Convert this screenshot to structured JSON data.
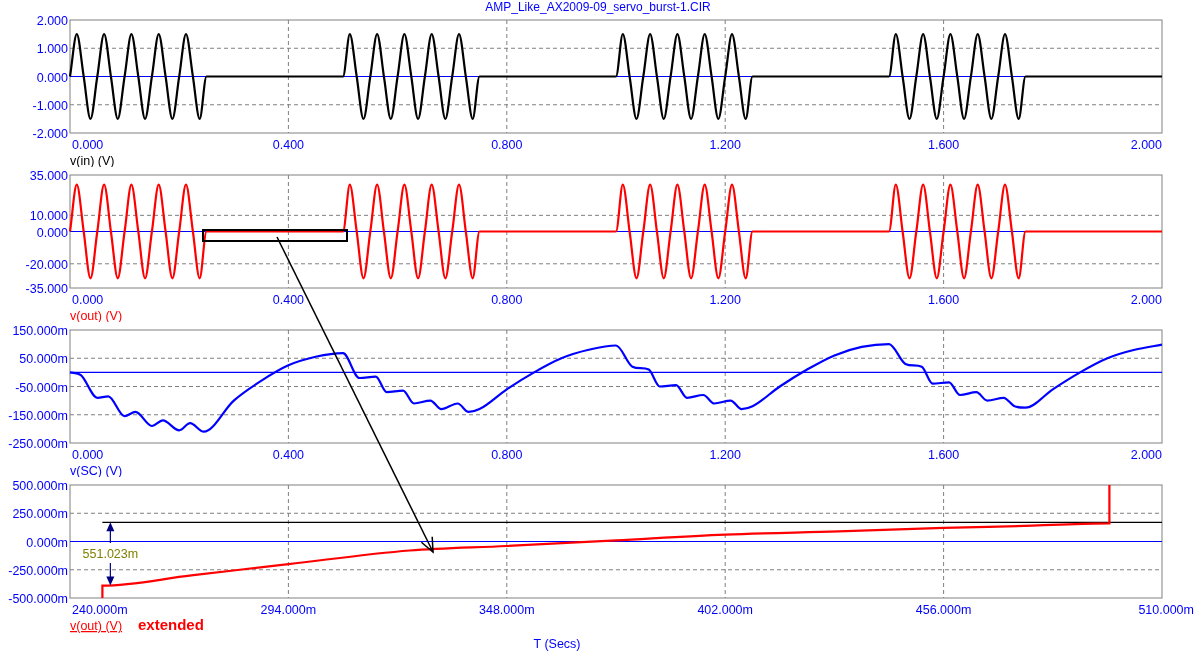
{
  "title": "AMP_Like_AX2009-09_servo_burst-1.CIR",
  "plots": [
    {
      "chart_data": {
        "type": "line",
        "grid": true,
        "ref_lines": [
          {
            "axis": "y",
            "value": 0,
            "color": "#0000ff"
          }
        ],
        "xlim": [
          0,
          2
        ],
        "ylim": [
          -2,
          2
        ],
        "xticks": [
          {
            "value": 0,
            "label": "0.000"
          },
          {
            "value": 0.4,
            "label": "0.400"
          },
          {
            "value": 0.8,
            "label": "0.800"
          },
          {
            "value": 1.2,
            "label": "1.200"
          },
          {
            "value": 1.6,
            "label": "1.600"
          },
          {
            "value": 2,
            "label": "2.000"
          }
        ],
        "yticks": [
          {
            "value": 2,
            "label": "2.000"
          },
          {
            "value": 1,
            "label": "1.000"
          },
          {
            "value": 0,
            "label": "0.000"
          },
          {
            "value": -1,
            "label": "-1.000"
          },
          {
            "value": -2,
            "label": "-2.000"
          }
        ],
        "x": [
          0,
          0.0125,
          0.025,
          0.0375,
          0.05,
          0.0625,
          0.075,
          0.0875,
          0.1,
          0.1125,
          0.125,
          0.1375,
          0.15,
          0.1625,
          0.175,
          0.1875,
          0.2,
          0.2125,
          0.225,
          0.2375,
          0.25,
          0.5,
          0.5125,
          0.525,
          0.5375,
          0.55,
          0.5625,
          0.575,
          0.5875,
          0.6,
          0.6125,
          0.625,
          0.6375,
          0.65,
          0.6625,
          0.675,
          0.6875,
          0.7,
          0.7125,
          0.725,
          0.7375,
          0.75,
          1,
          1.0125,
          1.025,
          1.0375,
          1.05,
          1.0625,
          1.075,
          1.0875,
          1.1,
          1.1125,
          1.125,
          1.1375,
          1.15,
          1.1625,
          1.175,
          1.1875,
          1.2,
          1.2125,
          1.225,
          1.2375,
          1.25,
          1.5,
          1.5125,
          1.525,
          1.5375,
          1.55,
          1.5625,
          1.575,
          1.5875,
          1.6,
          1.6125,
          1.625,
          1.6375,
          1.65,
          1.6625,
          1.675,
          1.6875,
          1.7,
          1.7125,
          1.725,
          1.7375,
          1.75,
          2
        ],
        "series": [
          {
            "name": "v(in) (V)",
            "color": "#000000",
            "values": [
              0,
              1.5,
              0,
              -1.5,
              0,
              1.5,
              0,
              -1.5,
              0,
              1.5,
              0,
              -1.5,
              0,
              1.5,
              0,
              -1.5,
              0,
              1.5,
              0,
              -1.5,
              0,
              0,
              1.5,
              0,
              -1.5,
              0,
              1.5,
              0,
              -1.5,
              0,
              1.5,
              0,
              -1.5,
              0,
              1.5,
              0,
              -1.5,
              0,
              1.5,
              0,
              -1.5,
              0,
              0,
              1.5,
              0,
              -1.5,
              0,
              1.5,
              0,
              -1.5,
              0,
              1.5,
              0,
              -1.5,
              0,
              1.5,
              0,
              -1.5,
              0,
              1.5,
              0,
              -1.5,
              0,
              0,
              1.5,
              0,
              -1.5,
              0,
              1.5,
              0,
              -1.5,
              0,
              1.5,
              0,
              -1.5,
              0,
              1.5,
              0,
              -1.5,
              0,
              1.5,
              0,
              -1.5,
              0,
              0
            ]
          }
        ]
      }
    },
    {
      "chart_data": {
        "type": "line",
        "grid": true,
        "ref_lines": [
          {
            "axis": "y",
            "value": 0,
            "color": "#0000ff"
          }
        ],
        "xlim": [
          0,
          2
        ],
        "ylim": [
          -35,
          35
        ],
        "xticks": [
          {
            "value": 0,
            "label": "0.000"
          },
          {
            "value": 0.4,
            "label": "0.400"
          },
          {
            "value": 0.8,
            "label": "0.800"
          },
          {
            "value": 1.2,
            "label": "1.200"
          },
          {
            "value": 1.6,
            "label": "1.600"
          },
          {
            "value": 2,
            "label": "2.000"
          }
        ],
        "yticks": [
          {
            "value": 35,
            "label": "35.000"
          },
          {
            "value": 10,
            "label": "10.000"
          },
          {
            "value": 0,
            "label": "0.000"
          },
          {
            "value": -20,
            "label": "-20.000"
          },
          {
            "value": -35,
            "label": "-35.000"
          }
        ],
        "x": [
          0,
          0.0125,
          0.025,
          0.0375,
          0.05,
          0.0625,
          0.075,
          0.0875,
          0.1,
          0.1125,
          0.125,
          0.1375,
          0.15,
          0.1625,
          0.175,
          0.1875,
          0.2,
          0.2125,
          0.225,
          0.2375,
          0.25,
          0.5,
          0.5125,
          0.525,
          0.5375,
          0.55,
          0.5625,
          0.575,
          0.5875,
          0.6,
          0.6125,
          0.625,
          0.6375,
          0.65,
          0.6625,
          0.675,
          0.6875,
          0.7,
          0.7125,
          0.725,
          0.7375,
          0.75,
          1,
          1.0125,
          1.025,
          1.0375,
          1.05,
          1.0625,
          1.075,
          1.0875,
          1.1,
          1.1125,
          1.125,
          1.1375,
          1.15,
          1.1625,
          1.175,
          1.1875,
          1.2,
          1.2125,
          1.225,
          1.2375,
          1.25,
          1.5,
          1.5125,
          1.525,
          1.5375,
          1.55,
          1.5625,
          1.575,
          1.5875,
          1.6,
          1.6125,
          1.625,
          1.6375,
          1.65,
          1.6625,
          1.675,
          1.6875,
          1.7,
          1.7125,
          1.725,
          1.7375,
          1.75,
          2
        ],
        "series": [
          {
            "name": "v(out) (V)",
            "color": "#ff0000",
            "values": [
              0,
              29,
              0,
              -29,
              0,
              29,
              0,
              -29,
              0,
              29,
              0,
              -29,
              0,
              29,
              0,
              -29,
              0,
              29,
              0,
              -29,
              0,
              0,
              29,
              0,
              -29,
              0,
              29,
              0,
              -29,
              0,
              29,
              0,
              -29,
              0,
              29,
              0,
              -29,
              0,
              29,
              0,
              -29,
              0,
              0,
              29,
              0,
              -29,
              0,
              29,
              0,
              -29,
              0,
              29,
              0,
              -29,
              0,
              29,
              0,
              -29,
              0,
              29,
              0,
              -29,
              0,
              0,
              29,
              0,
              -29,
              0,
              29,
              0,
              -29,
              0,
              29,
              0,
              -29,
              0,
              29,
              0,
              -29,
              0,
              29,
              0,
              -29,
              0,
              0
            ]
          }
        ]
      }
    },
    {
      "chart_data": {
        "type": "line",
        "grid": true,
        "ref_lines": [
          {
            "axis": "y",
            "value": 0,
            "color": "#0000ff"
          }
        ],
        "xlim": [
          0,
          2
        ],
        "ylim": [
          -250,
          150
        ],
        "xticks": [
          {
            "value": 0,
            "label": "0.000"
          },
          {
            "value": 0.4,
            "label": "0.400"
          },
          {
            "value": 0.8,
            "label": "0.800"
          },
          {
            "value": 1.2,
            "label": "1.200"
          },
          {
            "value": 1.6,
            "label": "1.600"
          },
          {
            "value": 2,
            "label": "2.000"
          }
        ],
        "yticks": [
          {
            "value": 150,
            "label": "150.000m"
          },
          {
            "value": 50,
            "label": "50.000m"
          },
          {
            "value": -50,
            "label": "-50.000m"
          },
          {
            "value": -150,
            "label": "-150.000m"
          },
          {
            "value": -250,
            "label": "-250.000m"
          }
        ],
        "x": [
          0,
          0.02,
          0.05,
          0.07,
          0.1,
          0.12,
          0.15,
          0.17,
          0.2,
          0.22,
          0.245,
          0.3,
          0.35,
          0.4,
          0.45,
          0.5,
          0.53,
          0.56,
          0.58,
          0.61,
          0.63,
          0.66,
          0.68,
          0.71,
          0.73,
          0.75,
          0.8,
          0.85,
          0.9,
          0.95,
          1,
          1.03,
          1.06,
          1.08,
          1.11,
          1.13,
          1.16,
          1.18,
          1.21,
          1.23,
          1.25,
          1.3,
          1.35,
          1.4,
          1.45,
          1.5,
          1.53,
          1.56,
          1.58,
          1.61,
          1.63,
          1.66,
          1.68,
          1.71,
          1.73,
          1.75,
          1.8,
          1.85,
          1.9,
          1.95,
          2
        ],
        "series": [
          {
            "name": "v(SC) (V)",
            "color": "#0000ff",
            "values": [
              0,
              -10,
              -90,
              -85,
              -155,
              -140,
              -190,
              -170,
              -205,
              -180,
              -210,
              -100,
              -30,
              25,
              55,
              68,
              -20,
              -15,
              -70,
              -65,
              -110,
              -100,
              -130,
              -110,
              -140,
              -130,
              -60,
              0,
              50,
              80,
              95,
              20,
              10,
              -50,
              -45,
              -90,
              -80,
              -110,
              -100,
              -130,
              -120,
              -50,
              10,
              60,
              90,
              100,
              30,
              20,
              -40,
              -35,
              -80,
              -70,
              -100,
              -90,
              -120,
              -125,
              -60,
              0,
              50,
              80,
              98
            ]
          }
        ]
      }
    },
    {
      "note": "extended",
      "trace_underlined": true,
      "chart_data": {
        "type": "line",
        "grid": true,
        "xlabel": "T (Secs)",
        "xlim": [
          240,
          510
        ],
        "ylim": [
          -500,
          500
        ],
        "xticks": [
          {
            "value": 240,
            "label": "240.000m"
          },
          {
            "value": 294,
            "label": "294.000m"
          },
          {
            "value": 348,
            "label": "348.000m"
          },
          {
            "value": 402,
            "label": "402.000m"
          },
          {
            "value": 456,
            "label": "456.000m"
          },
          {
            "value": 510,
            "label": "510.000m"
          }
        ],
        "yticks": [
          {
            "value": 500,
            "label": "500.000m"
          },
          {
            "value": 250,
            "label": "250.000m"
          },
          {
            "value": 0,
            "label": "0.000m"
          },
          {
            "value": -250,
            "label": "-250.000m"
          },
          {
            "value": -500,
            "label": "-500.000m"
          }
        ],
        "x": [
          248,
          248,
          270,
          294,
          324,
          348,
          375,
          402,
          430,
          456,
          478,
          497,
          497
        ],
        "series": [
          {
            "name": "v(out) (V)",
            "color": "#ff0000",
            "values": [
              -500,
              -390,
              -300,
              -200,
              -80,
              -40,
              10,
              60,
              90,
              120,
              140,
              160,
              500
            ]
          }
        ],
        "ref_lines": [
          {
            "axis": "y",
            "value": 0,
            "color": "#0000ff"
          },
          {
            "axis": "y",
            "value": 170,
            "color": "#000000"
          }
        ],
        "annotations": [
          "551.023m"
        ]
      }
    }
  ]
}
